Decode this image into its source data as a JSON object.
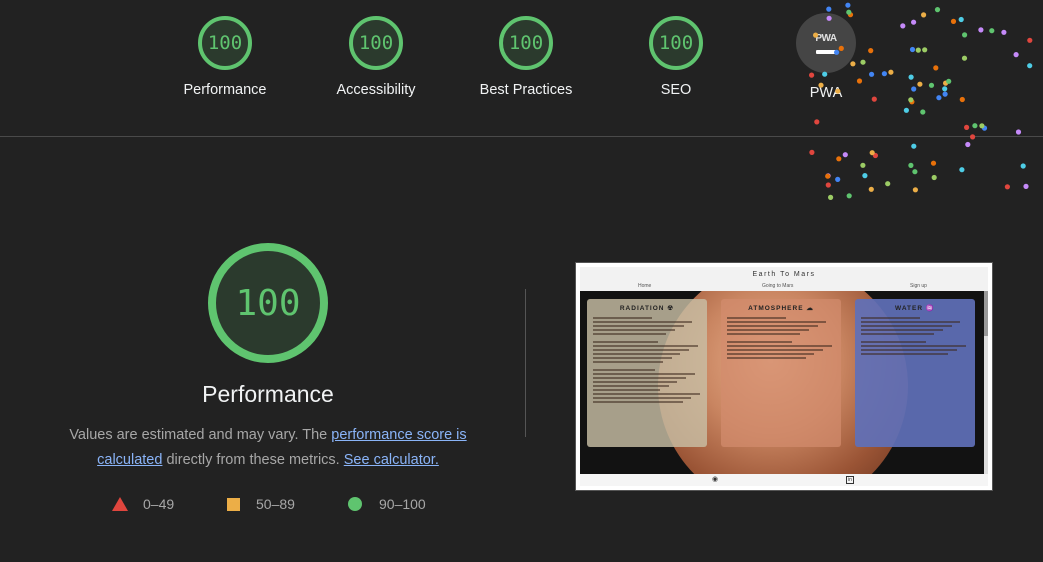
{
  "header": {
    "categories": [
      {
        "score": "100",
        "label": "Performance"
      },
      {
        "score": "100",
        "label": "Accessibility"
      },
      {
        "score": "100",
        "label": "Best Practices"
      },
      {
        "score": "100",
        "label": "SEO"
      }
    ],
    "pwa": {
      "badge_text": "PWA",
      "label": "PWA"
    }
  },
  "main": {
    "score": "100",
    "title": "Performance",
    "description": {
      "prefix": "Values are estimated and may vary. The ",
      "link1": "performance score is calculated",
      "middle": " directly from these metrics. ",
      "link2": "See calculator."
    },
    "legend": [
      {
        "range": "0–49",
        "shape": "triangle",
        "color": "#e0463e"
      },
      {
        "range": "50–89",
        "shape": "square",
        "color": "#ecae47"
      },
      {
        "range": "90–100",
        "shape": "circle",
        "color": "#5fc46f"
      }
    ]
  },
  "screenshot": {
    "site_title": "Earth To Mars",
    "nav": [
      "Home",
      "Going to Mars",
      "Sign up"
    ],
    "cards": [
      {
        "title": "RADIATION ☢",
        "bg": "rgba(200,190,165,0.82)"
      },
      {
        "title": "ATMOSPHERE ☁",
        "bg": "rgba(210,140,110,0.72)"
      },
      {
        "title": "WATER ♒",
        "bg": "rgba(96,112,185,0.92)"
      }
    ],
    "footer_icons": [
      "github-icon",
      "linkedin-icon"
    ]
  },
  "colors": {
    "pass": "#5fc46f",
    "average": "#ecae47",
    "fail": "#e0463e",
    "link": "#8ab4f8"
  }
}
